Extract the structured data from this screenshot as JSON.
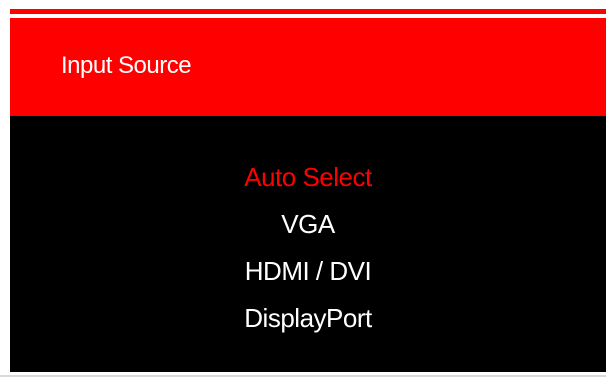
{
  "header": {
    "title": "Input Source"
  },
  "menu": {
    "selected_index": 0,
    "items": [
      {
        "label": "Auto Select"
      },
      {
        "label": "VGA"
      },
      {
        "label": "HDMI / DVI"
      },
      {
        "label": "DisplayPort"
      }
    ]
  },
  "colors": {
    "accent": "#fe0000",
    "background": "#000000",
    "text": "#ffffff"
  }
}
